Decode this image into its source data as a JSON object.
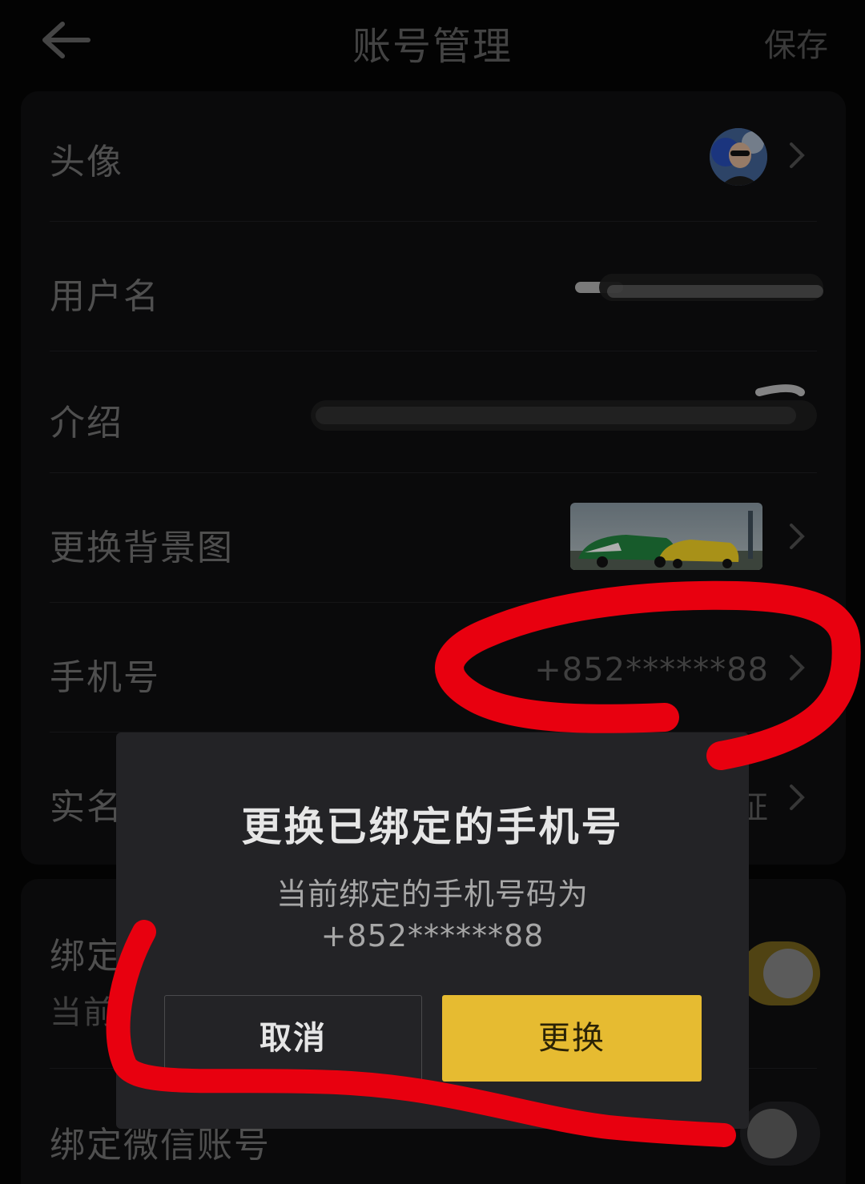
{
  "header": {
    "title": "账号管理",
    "save_label": "保存"
  },
  "rows": {
    "avatar_label": "头像",
    "username_label": "用户名",
    "intro_label": "介绍",
    "background_label": "更换背景图",
    "phone_label": "手机号",
    "phone_value": "+852******88",
    "realname_label_visible": "实名",
    "realname_value_tail": "证"
  },
  "section2": {
    "bind_label_partial": "绑定",
    "bind_sub_partial": "当前",
    "wechat_label": "绑定微信账号"
  },
  "dialog": {
    "title": "更换已绑定的手机号",
    "message_line1": "当前绑定的手机号码为",
    "message_line2": "+852******88",
    "cancel_label": "取消",
    "confirm_label": "更换"
  },
  "colors": {
    "accent": "#e6bb31",
    "annotation": "#e8000f",
    "dialog_bg": "#232326",
    "background": "#050505"
  },
  "icons": {
    "back": "arrow-left-icon",
    "chevron": "chevron-right-icon"
  }
}
